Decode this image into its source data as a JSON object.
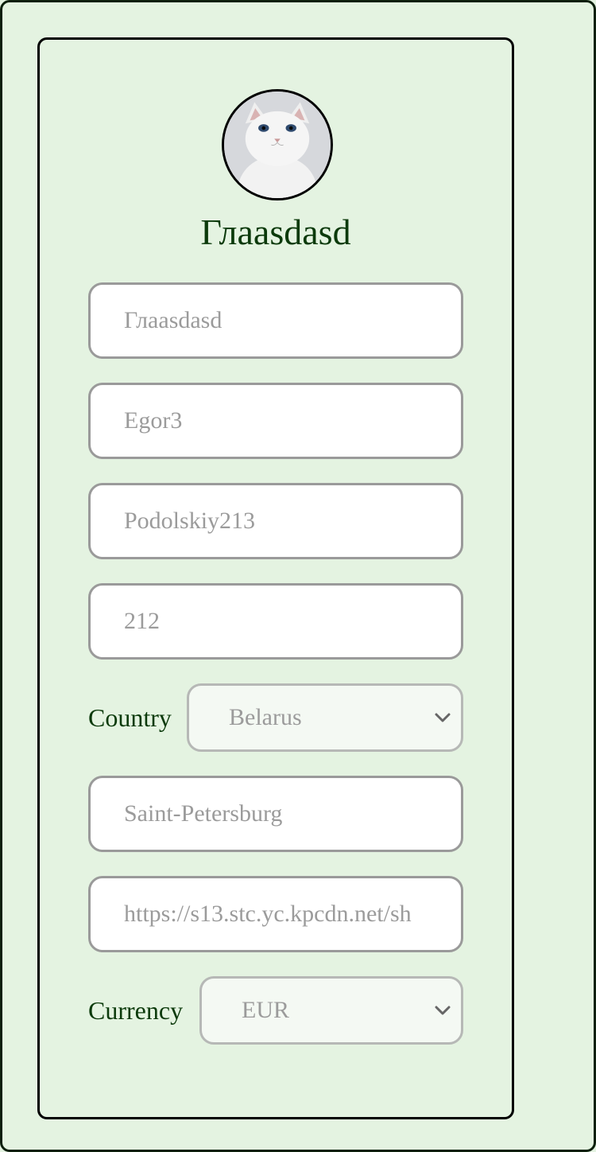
{
  "profile": {
    "name": "Глaasdasd"
  },
  "fields": {
    "display_name": {
      "placeholder": "Глaasdasd"
    },
    "first_name": {
      "placeholder": "Egor3"
    },
    "last_name": {
      "placeholder": "Podolskiy213"
    },
    "age": {
      "placeholder": "212"
    },
    "city": {
      "placeholder": "Saint-Petersburg"
    },
    "avatar_url": {
      "placeholder": "https://s13.stc.yc.kpcdn.net/sh"
    }
  },
  "country": {
    "label": "Country",
    "selected": "Belarus"
  },
  "currency": {
    "label": "Currency",
    "selected": "EUR"
  },
  "icons": {
    "avatar": "cat-avatar-image",
    "dropdown": "chevron-down-icon"
  },
  "colors": {
    "background": "#e4f3e1",
    "title": "#0b3a0b",
    "field_border": "#9a9a9a",
    "placeholder": "#9b9b9b"
  }
}
